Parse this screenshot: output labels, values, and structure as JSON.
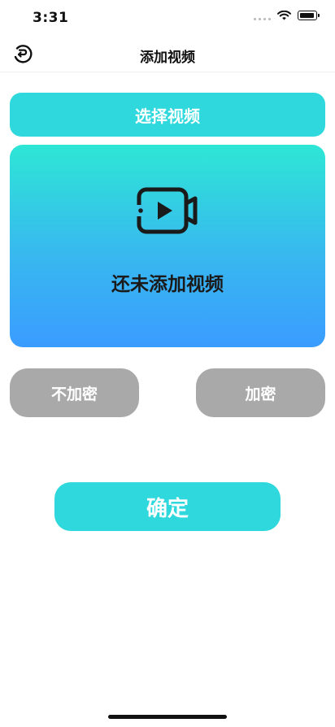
{
  "status_bar": {
    "time": "3:31",
    "icons": [
      "signal-dots-icon",
      "wifi-icon",
      "battery-icon"
    ]
  },
  "nav": {
    "title": "添加视频",
    "back_icon": "back-icon"
  },
  "select_button": {
    "label": "选择视频"
  },
  "preview": {
    "icon": "video-camera-icon",
    "empty_text": "还未添加视频",
    "gradient": [
      "#2ee6d6",
      "#3a9cff"
    ]
  },
  "options": {
    "no_encrypt_label": "不加密",
    "encrypt_label": "加密"
  },
  "confirm_button": {
    "label": "确定"
  },
  "colors": {
    "accent": "#2ed8dc",
    "disabled": "#a9a9a9"
  }
}
